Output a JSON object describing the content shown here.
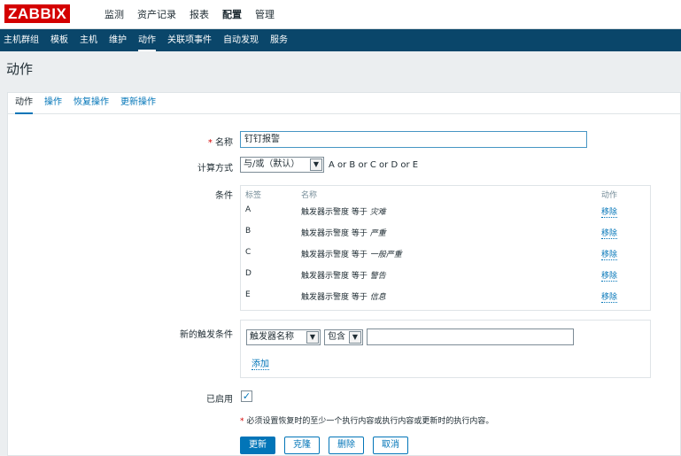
{
  "logo": "ZABBIX",
  "top_nav": [
    {
      "label": "监测",
      "active": false
    },
    {
      "label": "资产记录",
      "active": false
    },
    {
      "label": "报表",
      "active": false
    },
    {
      "label": "配置",
      "active": true
    },
    {
      "label": "管理",
      "active": false
    }
  ],
  "sub_nav": [
    {
      "label": "主机群组",
      "active": false
    },
    {
      "label": "模板",
      "active": false
    },
    {
      "label": "主机",
      "active": false
    },
    {
      "label": "维护",
      "active": false
    },
    {
      "label": "动作",
      "active": true
    },
    {
      "label": "关联项事件",
      "active": false
    },
    {
      "label": "自动发现",
      "active": false
    },
    {
      "label": "服务",
      "active": false
    }
  ],
  "page_title": "动作",
  "tabs": [
    {
      "label": "动作",
      "active": true
    },
    {
      "label": "操作",
      "active": false
    },
    {
      "label": "恢复操作",
      "active": false
    },
    {
      "label": "更新操作",
      "active": false
    }
  ],
  "form": {
    "name_label": "名称",
    "name_required": "*",
    "name_value": "钉钉报警",
    "calc_label": "计算方式",
    "calc_value": "与/或（默认）",
    "calc_formula": "A or B or C or D or E",
    "conditions_label": "条件",
    "conditions_headers": {
      "label": "标签",
      "name": "名称",
      "action": "动作"
    },
    "conditions": [
      {
        "label": "A",
        "text": "触发器示警度 等于 ",
        "value": "灾难",
        "action": "移除"
      },
      {
        "label": "B",
        "text": "触发器示警度 等于 ",
        "value": "严重",
        "action": "移除"
      },
      {
        "label": "C",
        "text": "触发器示警度 等于 ",
        "value": "一般严重",
        "action": "移除"
      },
      {
        "label": "D",
        "text": "触发器示警度 等于 ",
        "value": "警告",
        "action": "移除"
      },
      {
        "label": "E",
        "text": "触发器示警度 等于 ",
        "value": "信息",
        "action": "移除"
      }
    ],
    "new_condition_label": "新的触发条件",
    "new_condition_type": "触发器名称",
    "new_condition_operator": "包含",
    "new_condition_value": "",
    "add_link": "添加",
    "enabled_label": "已启用",
    "enabled_checked": true,
    "note_star": "*",
    "note": "必须设置恢复时的至少一个执行内容或执行内容或更新时的执行内容。"
  },
  "buttons": {
    "update": "更新",
    "clone": "克隆",
    "delete": "删除",
    "cancel": "取消"
  },
  "colors": {
    "brand": "#d40000",
    "nav_bg": "#0a466a",
    "link": "#0275b8",
    "primary_button": "#0275b8"
  }
}
